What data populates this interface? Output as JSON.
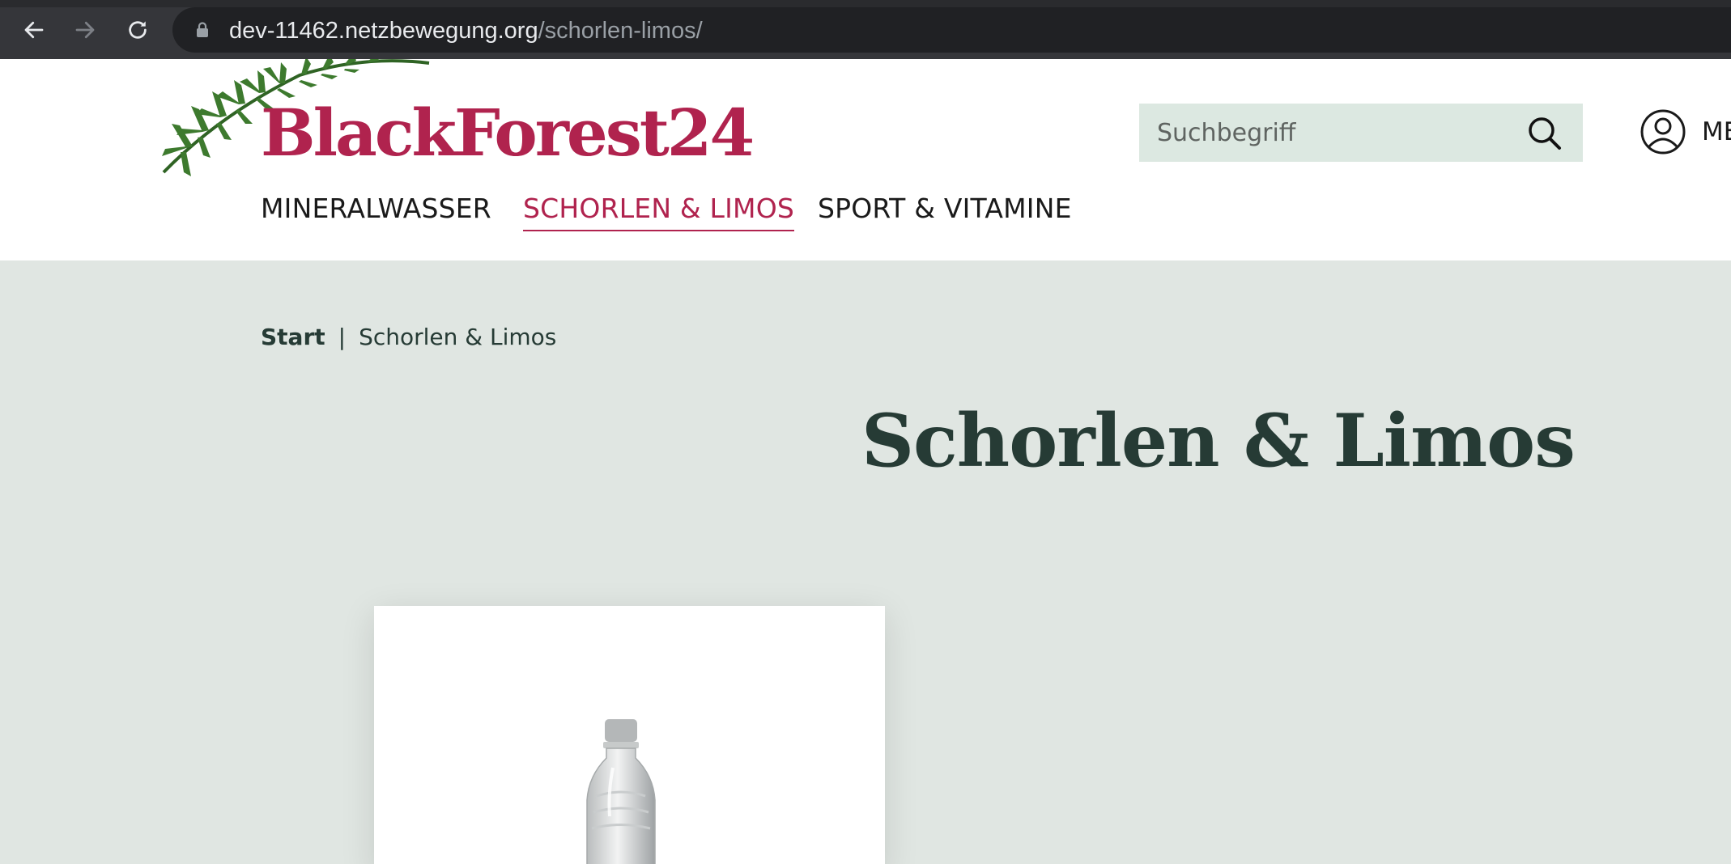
{
  "browser": {
    "url_host": "dev-11462.netzbewegung.org",
    "url_path": "/schorlen-limos/"
  },
  "header": {
    "logo_text": "BlackForest24",
    "search_placeholder": "Suchbegriff",
    "account_label": "ME"
  },
  "nav": {
    "items": [
      {
        "label": "MINERALWASSER",
        "active": false
      },
      {
        "label": "SCHORLEN & LIMOS",
        "active": true
      },
      {
        "label": "SPORT & VITAMINE",
        "active": false
      }
    ]
  },
  "breadcrumb": {
    "start": "Start",
    "separator": "|",
    "current": "Schorlen & Limos"
  },
  "page": {
    "title": "Schorlen & Limos"
  },
  "colors": {
    "brand": "#b0234e",
    "content_bg": "#e0e6e2",
    "search_bg": "#dce8e1",
    "heading": "#263b35"
  },
  "icons": {
    "back": "arrow-left-icon",
    "forward": "arrow-right-icon",
    "reload": "reload-icon",
    "lock": "lock-icon",
    "search": "search-icon",
    "account": "user-circle-icon"
  }
}
